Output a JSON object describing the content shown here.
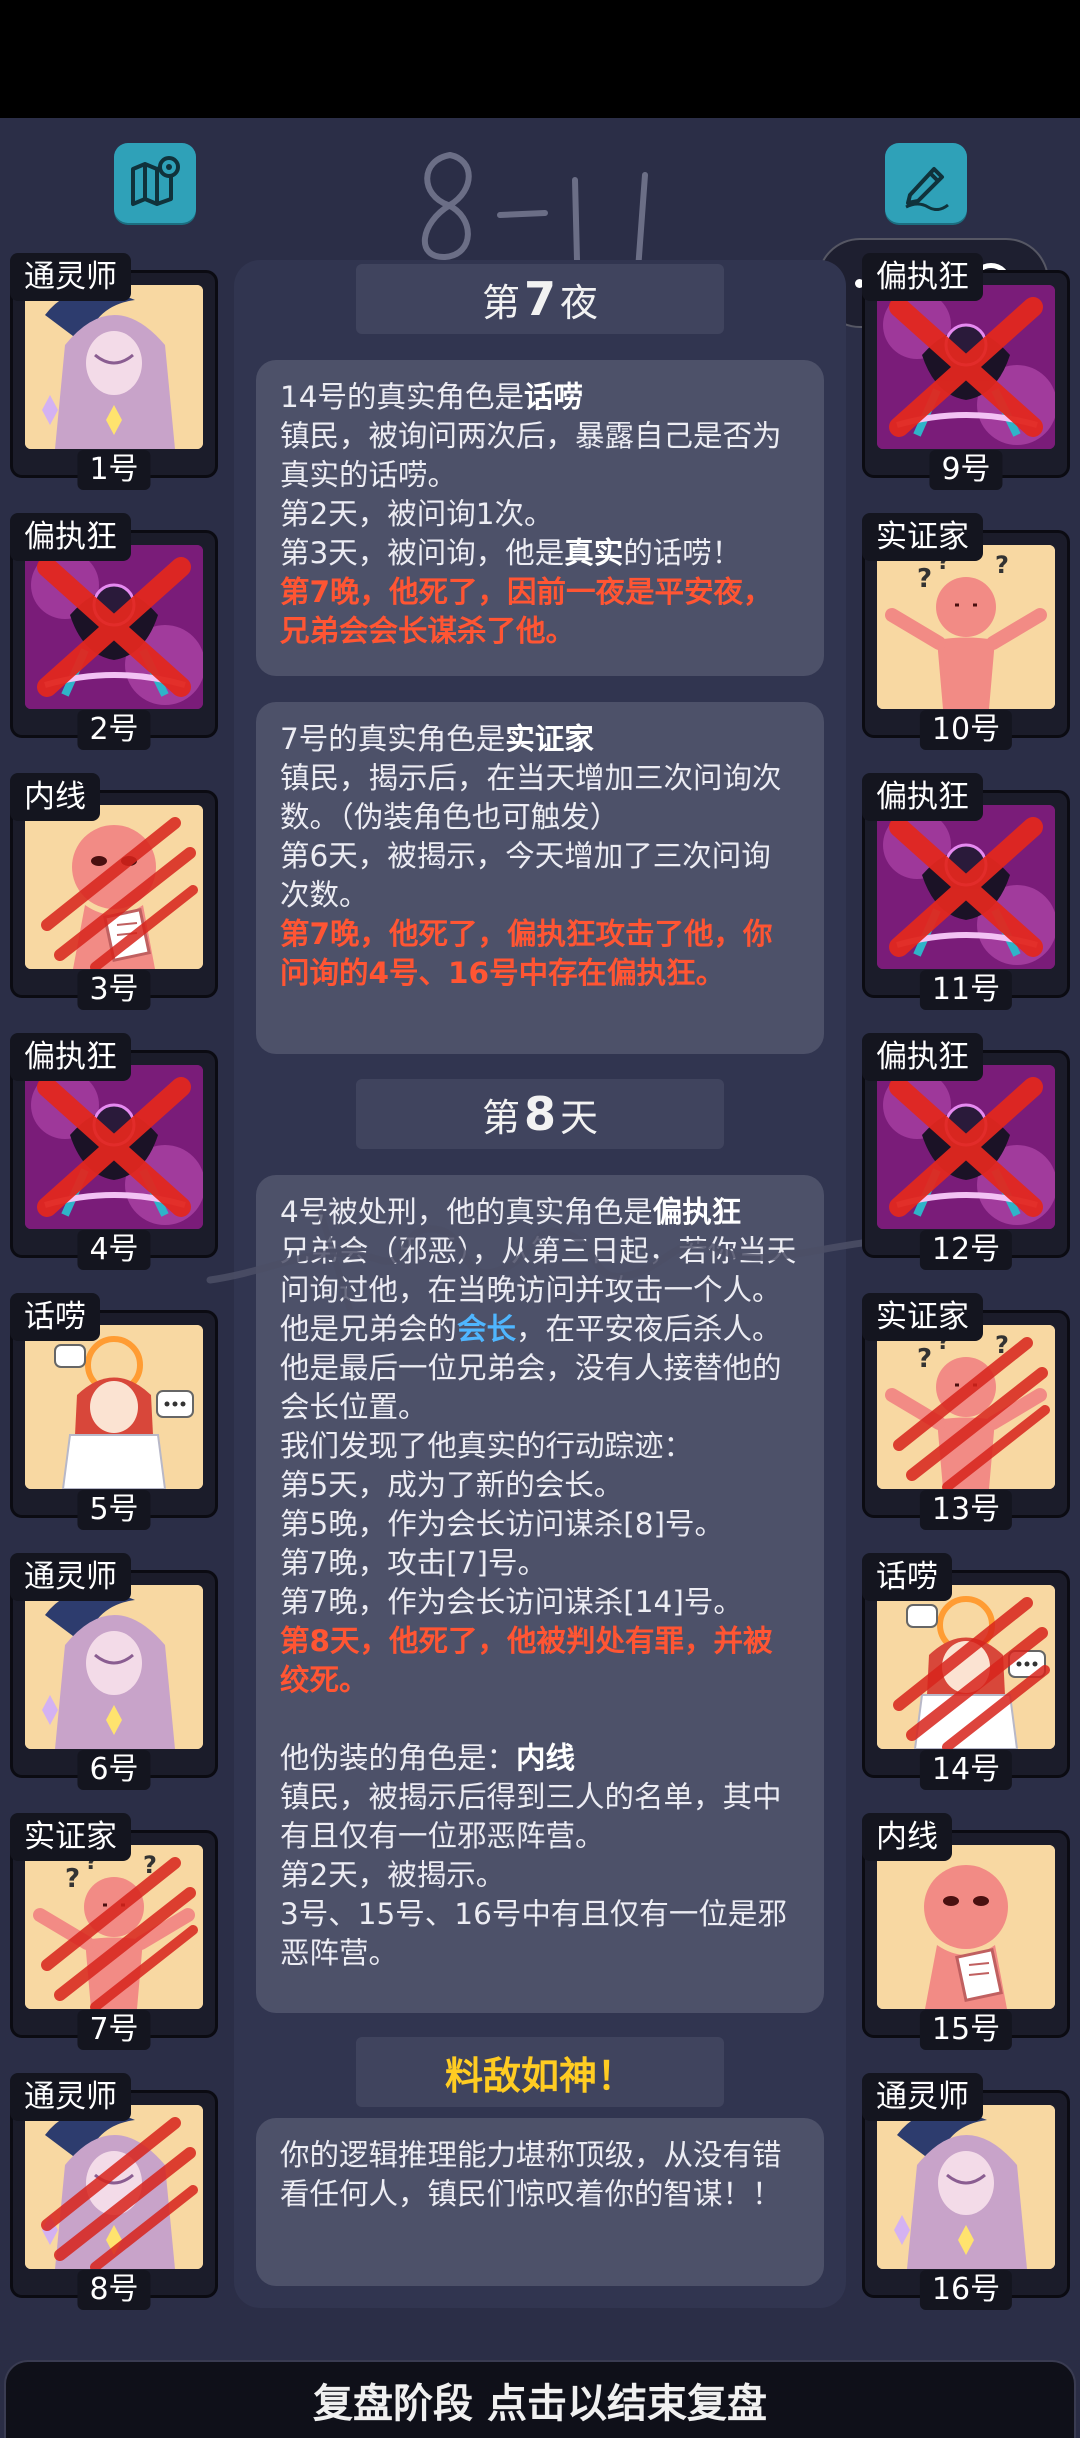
{
  "header": {
    "map_button_icon": "map-icon",
    "note_button_icon": "pencil-note-icon",
    "handwritten_note": "8-11",
    "capsule_icons": [
      "more-dots-icon",
      "close-target-icon"
    ]
  },
  "players_left": [
    {
      "role": "通灵师",
      "num": "1号",
      "art": "medium",
      "dead": false
    },
    {
      "role": "偏执狂",
      "num": "2号",
      "art": "paranoid",
      "dead": true,
      "mark": "x"
    },
    {
      "role": "内线",
      "num": "3号",
      "art": "insider",
      "dead": true,
      "mark": "claw"
    },
    {
      "role": "偏执狂",
      "num": "4号",
      "art": "paranoid",
      "dead": true,
      "mark": "x"
    },
    {
      "role": "话唠",
      "num": "5号",
      "art": "chatter",
      "dead": false
    },
    {
      "role": "通灵师",
      "num": "6号",
      "art": "medium",
      "dead": false
    },
    {
      "role": "实证家",
      "num": "7号",
      "art": "empiricist",
      "dead": true,
      "mark": "claw"
    },
    {
      "role": "通灵师",
      "num": "8号",
      "art": "medium",
      "dead": true,
      "mark": "claw"
    }
  ],
  "players_right": [
    {
      "role": "偏执狂",
      "num": "9号",
      "art": "paranoid",
      "dead": true,
      "mark": "x"
    },
    {
      "role": "实证家",
      "num": "10号",
      "art": "empiricist",
      "dead": false
    },
    {
      "role": "偏执狂",
      "num": "11号",
      "art": "paranoid",
      "dead": true,
      "mark": "x"
    },
    {
      "role": "偏执狂",
      "num": "12号",
      "art": "paranoid",
      "dead": true,
      "mark": "x"
    },
    {
      "role": "实证家",
      "num": "13号",
      "art": "empiricist",
      "dead": true,
      "mark": "claw"
    },
    {
      "role": "话唠",
      "num": "14号",
      "art": "chatter",
      "dead": true,
      "mark": "claw"
    },
    {
      "role": "内线",
      "num": "15号",
      "art": "insider",
      "dead": false
    },
    {
      "role": "通灵师",
      "num": "16号",
      "art": "medium",
      "dead": false
    }
  ],
  "night7": {
    "title_prefix": "第",
    "title_num": "7",
    "title_suffix": "夜",
    "box1": {
      "l1_a": "14号的真实角色是",
      "l1_b": "话唠",
      "l2": "镇民，被询问两次后，暴露自己是否为真实的话唠。",
      "l3": "第2天，被问询1次。",
      "l4_a": "第3天，被问询，他是",
      "l4_b": "真实",
      "l4_c": "的话唠！",
      "l5": "第7晚，他死了，因前一夜是平安夜，兄弟会会长谋杀了他。"
    },
    "box2": {
      "l1_a": "7号的真实角色是",
      "l1_b": "实证家",
      "l2": "镇民，揭示后，在当天增加三次问询次数。（伪装角色也可触发）",
      "l3": "第6天，被揭示，今天增加了三次问询次数。",
      "l4": "第7晚，他死了，偏执狂攻击了他，你问询的4号、16号中存在偏执狂。"
    }
  },
  "day8": {
    "title_prefix": "第",
    "title_num": "8",
    "title_suffix": "天",
    "box": {
      "l1_a": "4号被处刑，他的真实角色是",
      "l1_b": "偏执狂",
      "l2": "兄弟会（邪恶），从第三日起，若你当天问询过他，在当晚访问并攻击一个人。",
      "l3_a": "他是兄弟会的",
      "l3_b": "会长",
      "l3_c": "，在平安夜后杀人。他是最后一位兄弟会，没有人接替他的会长位置。",
      "l4": "我们发现了他真实的行动踪迹：",
      "l5": "第5天，成为了新的会长。",
      "l6": "第5晚，作为会长访问谋杀[8]号。",
      "l7": "第7晚，攻击[7]号。",
      "l8": "第7晚，作为会长访问谋杀[14]号。",
      "l9": "第8天，他死了，他被判处有罪，并被绞死。",
      "l10_a": "他伪装的角色是：",
      "l10_b": "内线",
      "l11": "镇民，被揭示后得到三人的名单，其中有且仅有一位邪恶阵营。",
      "l12": "第2天，被揭示。",
      "l13": "3号、15号、16号中有且仅有一位是邪恶阵营。"
    }
  },
  "verdict": {
    "title": "料敌如神！",
    "text": "你的逻辑推理能力堪称顶级，从没有错看任何人，镇民们惊叹着你的智谋！！"
  },
  "bottom_bar": {
    "label": "复盘阶段 点击以结束复盘"
  },
  "colors": {
    "accent_red": "#ff5533",
    "accent_blue": "#4fb6ff",
    "accent_gold": "#ffcc22",
    "button_teal": "#2fa1b8"
  }
}
